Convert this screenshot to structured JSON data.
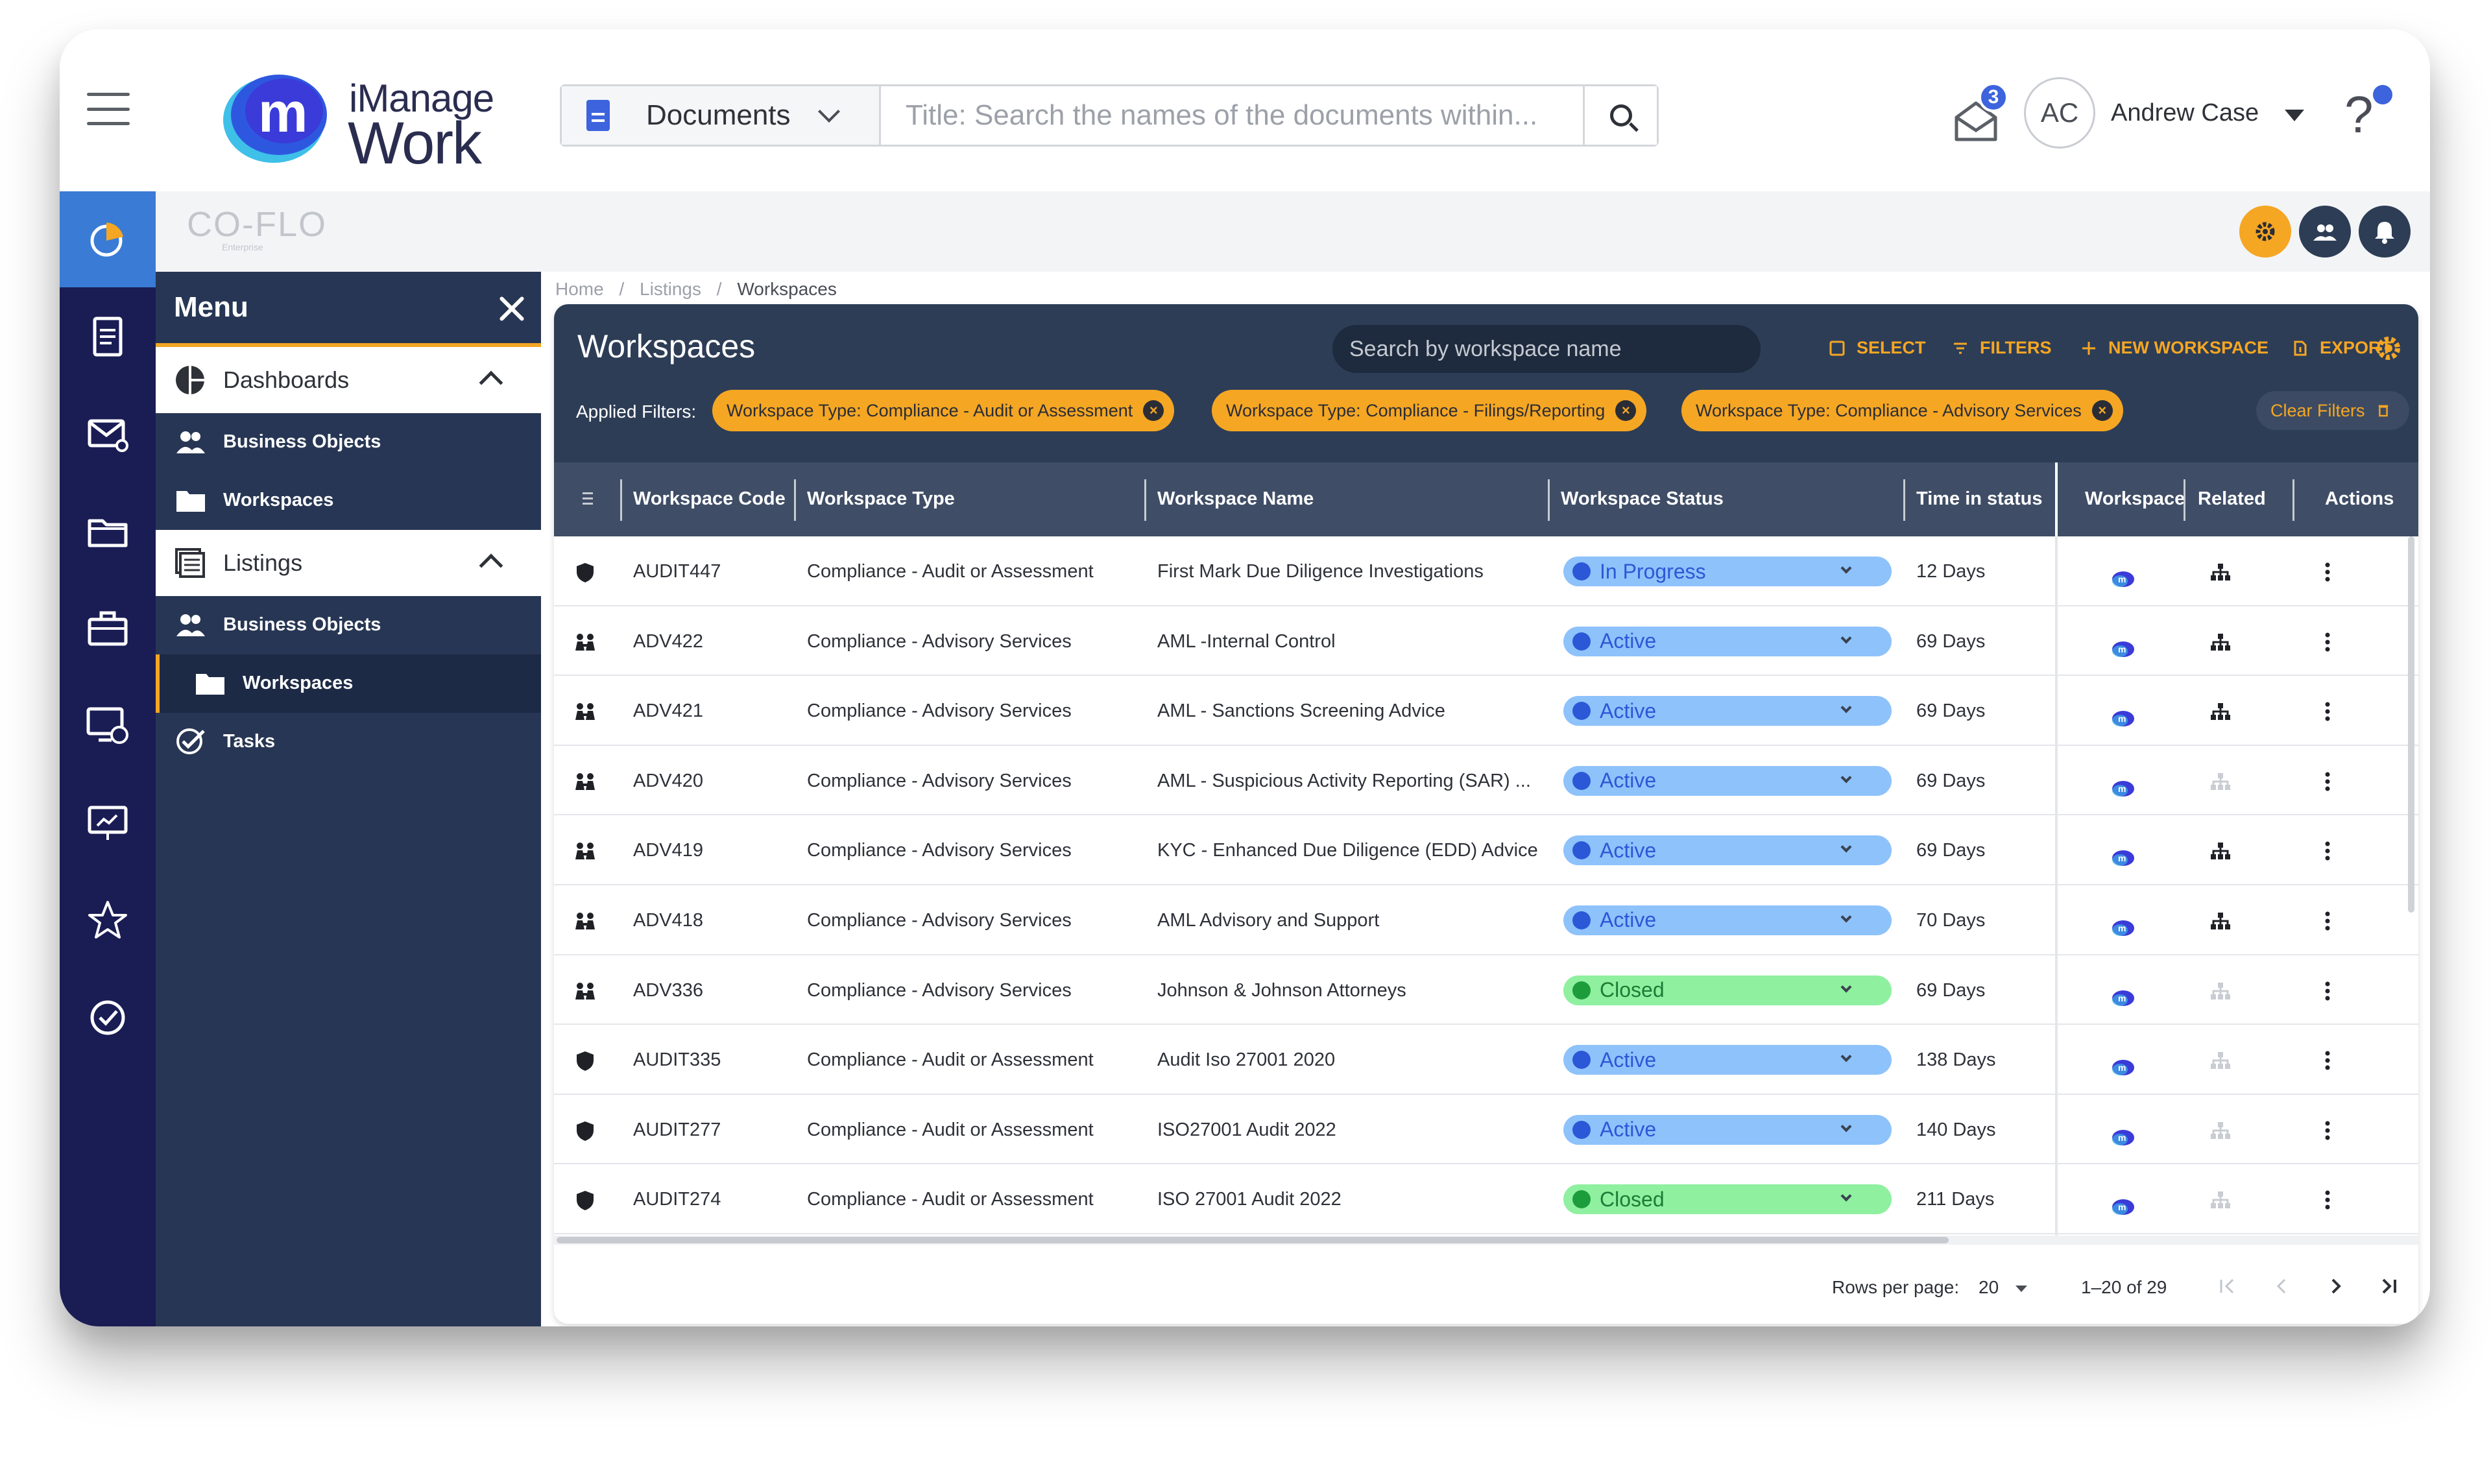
{
  "header": {
    "logo_top": "iManage",
    "logo_bottom": "Work",
    "doc_type": "Documents",
    "search_placeholder": "Title: Search the names of the documents within...",
    "notifications_count": "3",
    "user_initials": "AC",
    "user_name": "Andrew Case",
    "help_glyph": "?"
  },
  "subheader": {
    "brand": "CO-FLO",
    "brand_sub": "Enterprise"
  },
  "menu": {
    "title": "Menu",
    "sections": [
      {
        "label": "Dashboards",
        "items": [
          "Business Objects",
          "Workspaces"
        ]
      },
      {
        "label": "Listings",
        "items": [
          "Business Objects",
          "Workspaces"
        ]
      }
    ],
    "tasks_label": "Tasks"
  },
  "breadcrumb": [
    "Home",
    "/",
    "Listings",
    "/",
    "Workspaces"
  ],
  "workspaces": {
    "title": "Workspaces",
    "search_placeholder": "Search by workspace name",
    "tools": {
      "select": "SELECT",
      "filters": "FILTERS",
      "new": "NEW WORKSPACE",
      "export": "EXPORT"
    },
    "applied_label": "Applied Filters:",
    "chips": [
      "Workspace Type: Compliance - Audit or Assessment",
      "Workspace Type: Compliance - Filings/Reporting",
      "Workspace Type: Compliance - Advisory Services"
    ],
    "clear_filters": "Clear Filters",
    "columns": [
      "Workspace Code",
      "Workspace Type",
      "Workspace Name",
      "Workspace Status",
      "Time in status",
      "Workspace",
      "Related",
      "Actions"
    ],
    "rows": [
      {
        "icon": "shield-icon",
        "code": "AUDIT447",
        "type": "Compliance - Audit or Assessment",
        "name": "First Mark Due Diligence Investigations",
        "status": "In Progress",
        "status_kind": "blue",
        "time": "12 Days",
        "related_active": true
      },
      {
        "icon": "team-icon",
        "code": "ADV422",
        "type": "Compliance - Advisory Services",
        "name": "AML -Internal Control",
        "status": "Active",
        "status_kind": "blue",
        "time": "69 Days",
        "related_active": true
      },
      {
        "icon": "team-icon",
        "code": "ADV421",
        "type": "Compliance - Advisory Services",
        "name": "AML - Sanctions Screening Advice",
        "status": "Active",
        "status_kind": "blue",
        "time": "69 Days",
        "related_active": true
      },
      {
        "icon": "team-icon",
        "code": "ADV420",
        "type": "Compliance - Advisory Services",
        "name": "AML - Suspicious Activity Reporting (SAR) ...",
        "status": "Active",
        "status_kind": "blue",
        "time": "69 Days",
        "related_active": false
      },
      {
        "icon": "team-icon",
        "code": "ADV419",
        "type": "Compliance - Advisory Services",
        "name": "KYC - Enhanced Due Diligence (EDD) Advice",
        "status": "Active",
        "status_kind": "blue",
        "time": "69 Days",
        "related_active": true
      },
      {
        "icon": "team-icon",
        "code": "ADV418",
        "type": "Compliance - Advisory Services",
        "name": "AML Advisory and Support",
        "status": "Active",
        "status_kind": "blue",
        "time": "70 Days",
        "related_active": true
      },
      {
        "icon": "team-icon",
        "code": "ADV336",
        "type": "Compliance - Advisory Services",
        "name": "Johnson & Johnson Attorneys",
        "status": "Closed",
        "status_kind": "green",
        "time": "69 Days",
        "related_active": false
      },
      {
        "icon": "shield-icon",
        "code": "AUDIT335",
        "type": "Compliance - Audit or Assessment",
        "name": "Audit Iso 27001 2020",
        "status": "Active",
        "status_kind": "blue",
        "time": "138 Days",
        "related_active": false
      },
      {
        "icon": "shield-icon",
        "code": "AUDIT277",
        "type": "Compliance - Audit or Assessment",
        "name": "ISO27001 Audit 2022",
        "status": "Active",
        "status_kind": "blue",
        "time": "140 Days",
        "related_active": false
      },
      {
        "icon": "shield-icon",
        "code": "AUDIT274",
        "type": "Compliance - Audit or Assessment",
        "name": "ISO 27001 Audit 2022",
        "status": "Closed",
        "status_kind": "green",
        "time": "211 Days",
        "related_active": false
      }
    ],
    "pager": {
      "rows_label": "Rows per page:",
      "rows_value": "20",
      "range": "1–20 of 29"
    }
  },
  "colors": {
    "accent": "#f5a623",
    "navy": "#1a1c54",
    "panel": "#2d3d56",
    "brand_blue": "#3d63dd"
  }
}
